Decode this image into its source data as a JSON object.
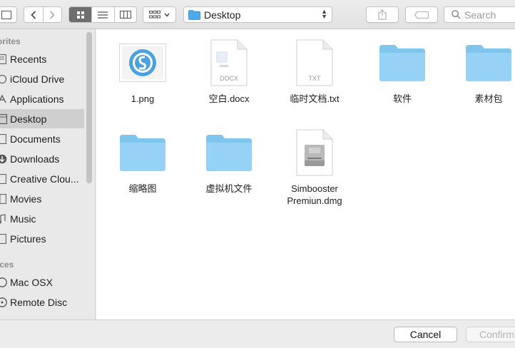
{
  "toolbar": {
    "path_label": "Desktop",
    "search_placeholder": "Search"
  },
  "sidebar": {
    "favorites_heading": "orites",
    "devices_heading": "ices",
    "items": [
      {
        "label": "Recents",
        "icon": "recents-icon"
      },
      {
        "label": "iCloud Drive",
        "icon": "cloud-icon"
      },
      {
        "label": "Applications",
        "icon": "applications-icon"
      },
      {
        "label": "Desktop",
        "icon": "desktop-icon",
        "selected": true
      },
      {
        "label": "Documents",
        "icon": "document-icon"
      },
      {
        "label": "Downloads",
        "icon": "download-icon"
      },
      {
        "label": "Creative Clou...",
        "icon": "creative-cloud-icon"
      },
      {
        "label": "Movies",
        "icon": "movies-icon"
      },
      {
        "label": "Music",
        "icon": "music-icon"
      },
      {
        "label": "Pictures",
        "icon": "pictures-icon"
      }
    ],
    "devices": [
      {
        "label": "Mac OSX",
        "icon": "disk-icon"
      },
      {
        "label": "Remote Disc",
        "icon": "remote-disc-icon"
      }
    ]
  },
  "files": [
    {
      "name": "1.png",
      "kind": "image"
    },
    {
      "name": "空白.docx",
      "kind": "docx",
      "badge": "DOCX"
    },
    {
      "name": "临时文档.txt",
      "kind": "txt",
      "badge": "TXT"
    },
    {
      "name": "软件",
      "kind": "folder"
    },
    {
      "name": "素材包",
      "kind": "folder"
    },
    {
      "name": "缩略图",
      "kind": "folder"
    },
    {
      "name": "虚拟机文件",
      "kind": "folder"
    },
    {
      "name": "Simbooster Premiun.dmg",
      "kind": "dmg",
      "name_line1": "Simbooster",
      "name_line2": "Premiun.dmg"
    }
  ],
  "buttons": {
    "cancel": "Cancel",
    "confirm": "Confirm"
  },
  "colors": {
    "folder": "#8fd1f6",
    "selected_row": "#cfcfcf",
    "active_segment": "#6e6e6e"
  }
}
